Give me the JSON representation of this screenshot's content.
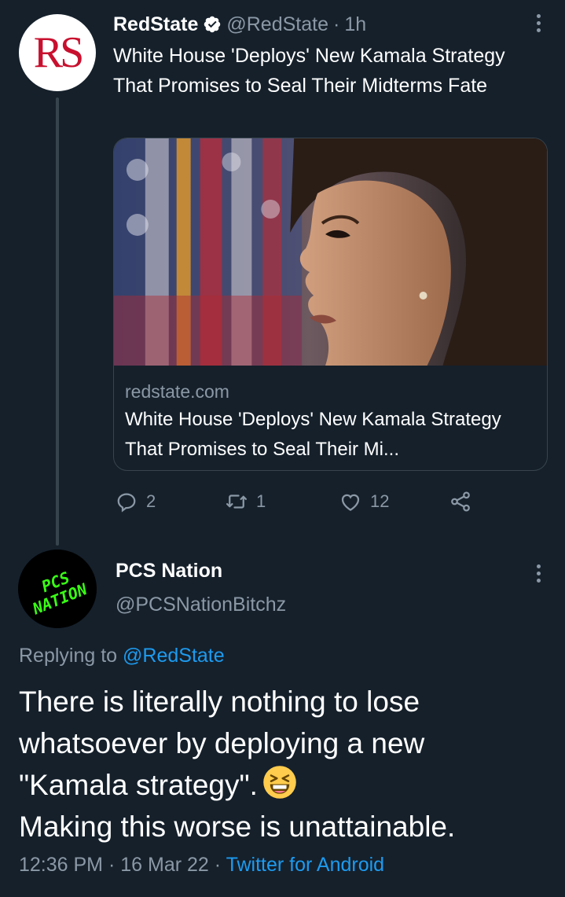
{
  "tweet1": {
    "author_name": "RedState",
    "handle": "@RedState",
    "separator": "·",
    "time": "1h",
    "avatar_text": "RS",
    "text": "White House 'Deploys' New Kamala Strategy That Promises to Seal Their Midterms Fate",
    "card": {
      "domain": "redstate.com",
      "title": "White House 'Deploys' New Kamala Strategy That Promises to Seal Their Mi..."
    },
    "actions": {
      "reply_count": "2",
      "retweet_count": "1",
      "like_count": "12"
    }
  },
  "tweet2": {
    "author_name": "PCS Nation",
    "handle": "@PCSNationBitchz",
    "avatar_text_line1": "PCS",
    "avatar_text_line2": "NATION",
    "replying_prefix": "Replying to",
    "replying_handle": "@RedState",
    "text_line1": "There is literally nothing to lose",
    "text_line2": "whatsoever by deploying a new",
    "text_line3": "\"Kamala strategy\".",
    "text_line4": "Making this worse is unattainable.",
    "time": "12:36 PM",
    "sep1": "·",
    "date": "16 Mar 22",
    "sep2": "·",
    "source": "Twitter for Android"
  },
  "icons": {
    "verified": "verified-badge-icon",
    "more": "more-options-icon",
    "reply": "reply-icon",
    "retweet": "retweet-icon",
    "like": "heart-icon",
    "share": "share-icon",
    "emoji": "grinning-squinting-face-emoji"
  },
  "colors": {
    "background": "#15202b",
    "text": "#ffffff",
    "muted": "#8b98a5",
    "link": "#1d9bf0",
    "border": "#38444d",
    "rs_red": "#c8102e",
    "pcs_green": "#39ff14"
  }
}
